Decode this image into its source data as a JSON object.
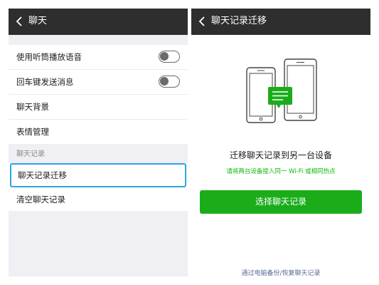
{
  "left_screen": {
    "title": "聊天",
    "settings_items": [
      {
        "label": "使用听筒播放语音",
        "toggle": false
      },
      {
        "label": "回车键发送消息",
        "toggle": false
      },
      {
        "label": "聊天背景"
      },
      {
        "label": "表情管理"
      }
    ],
    "history_group_title": "聊天记录",
    "history_items": [
      {
        "label": "聊天记录迁移",
        "highlighted": true
      },
      {
        "label": "清空聊天记录"
      }
    ]
  },
  "right_screen": {
    "title": "聊天记录迁移",
    "heading": "迁移聊天记录到另一台设备",
    "hint": "请将两台设备接入同一 Wi-Fi 或相同热点",
    "primary_button": "选择聊天记录",
    "footer_link": "通过电脑备份/恢复聊天记录"
  },
  "colors": {
    "navbar": "#2e2e2e",
    "accent_green": "#1aad19",
    "hint_green": "#09bb07",
    "highlight_border": "#2ba5e3",
    "link_blue": "#576b95",
    "page_gray": "#efeff4"
  }
}
